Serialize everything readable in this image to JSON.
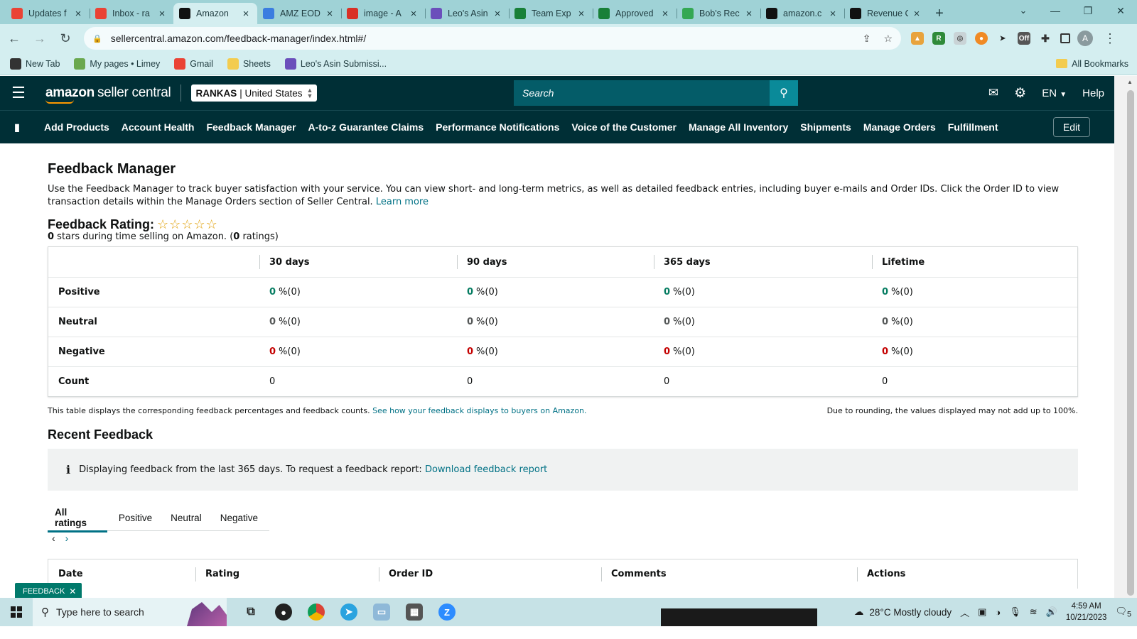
{
  "browser": {
    "tabs": [
      {
        "title": "Updates f",
        "icon": "gmail-icon",
        "color": "#ea4335",
        "active": false
      },
      {
        "title": "Inbox - ra",
        "icon": "gmail-icon",
        "color": "#ea4335",
        "active": false
      },
      {
        "title": "Amazon",
        "icon": "amazon-icon",
        "color": "#111111",
        "active": true
      },
      {
        "title": "AMZ EOD",
        "icon": "pencil-icon",
        "color": "#3b7de0",
        "active": false
      },
      {
        "title": "image - A",
        "icon": "v-icon",
        "color": "#d93025",
        "active": false
      },
      {
        "title": "Leo's Asin",
        "icon": "form-icon",
        "color": "#6b4fbb",
        "active": false
      },
      {
        "title": "Team Exp",
        "icon": "sheets-icon",
        "color": "#188038",
        "active": false
      },
      {
        "title": "Approved",
        "icon": "sheets-icon",
        "color": "#188038",
        "active": false
      },
      {
        "title": "Bob's Rec",
        "icon": "drive-icon",
        "color": "#34a853",
        "active": false
      },
      {
        "title": "amazon.c",
        "icon": "amazon-icon",
        "color": "#111111",
        "active": false
      },
      {
        "title": "Revenue C",
        "icon": "amazon-icon",
        "color": "#111111",
        "active": false
      }
    ],
    "url": "sellercentral.amazon.com/feedback-manager/index.html#/",
    "bookmarks": [
      {
        "label": "New Tab",
        "icon": "globe-icon"
      },
      {
        "label": "My pages • Limey",
        "icon": "leaf-icon"
      },
      {
        "label": "Gmail",
        "icon": "gmail-icon"
      },
      {
        "label": "Sheets",
        "icon": "folder-icon"
      },
      {
        "label": "Leo's Asin Submissi...",
        "icon": "form-icon"
      }
    ],
    "all_bookmarks": "All Bookmarks",
    "profile_initial": "A"
  },
  "header": {
    "logo_main": "amazon",
    "logo_sub": "seller central",
    "account_name": "RANKAS",
    "account_region": "| United States",
    "search_placeholder": "Search",
    "language": "EN",
    "help": "Help"
  },
  "nav": {
    "items": [
      "Add Products",
      "Account Health",
      "Feedback Manager",
      "A-to-z Guarantee Claims",
      "Performance Notifications",
      "Voice of the Customer",
      "Manage All Inventory",
      "Shipments",
      "Manage Orders",
      "Fulfillment"
    ],
    "edit": "Edit"
  },
  "page": {
    "title": "Feedback Manager",
    "intro": "Use the Feedback Manager to track buyer satisfaction with your service. You can view short- and long-term metrics, as well as detailed feedback entries, including buyer e-mails and Order IDs. Click the Order ID to view transaction details within the Manage Orders section of Seller Central.",
    "learn_more": "Learn more",
    "rating_label": "Feedback Rating:",
    "stars_shown": 0,
    "stars_max": 5,
    "rating_stars": "0",
    "rating_sub_a": " stars during time selling on Amazon. (",
    "rating_count": "0",
    "rating_sub_b": " ratings)"
  },
  "metrics": {
    "columns": [
      "30 days",
      "90 days",
      "365 days",
      "Lifetime"
    ],
    "rows": [
      {
        "label": "Positive",
        "values": [
          "0",
          "0",
          "0",
          "0"
        ],
        "suffix": "%(0)"
      },
      {
        "label": "Neutral",
        "values": [
          "0",
          "0",
          "0",
          "0"
        ],
        "suffix": "%(0)"
      },
      {
        "label": "Negative",
        "values": [
          "0",
          "0",
          "0",
          "0"
        ],
        "suffix": "%(0)"
      },
      {
        "label": "Count",
        "values": [
          "0",
          "0",
          "0",
          "0"
        ]
      }
    ],
    "note_left": "This table displays the corresponding feedback percentages and feedback counts.",
    "note_link": "See how your feedback displays to buyers on Amazon.",
    "note_right": "Due to rounding, the values displayed may not add up to 100%."
  },
  "recent": {
    "title": "Recent Feedback",
    "info_text": "Displaying feedback from the last 365 days. To request a feedback report:",
    "info_link": "Download feedback report",
    "tabs": [
      "All ratings",
      "Positive",
      "Neutral",
      "Negative"
    ],
    "columns": [
      "Date",
      "Rating",
      "Order ID",
      "Comments",
      "Actions"
    ]
  },
  "feedback_tag": "FEEDBACK",
  "taskbar": {
    "search_placeholder": "Type here to search",
    "weather": "28°C  Mostly cloudy",
    "time": "4:59 AM",
    "date": "10/21/2023",
    "notifications": "5"
  }
}
